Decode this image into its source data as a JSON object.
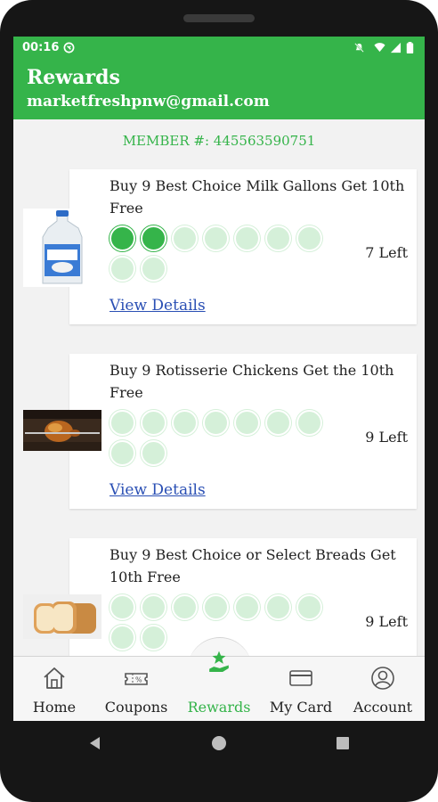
{
  "status_bar": {
    "time": "00:16"
  },
  "app_bar": {
    "title": "Rewards",
    "email": "marketfreshpnw@gmail.com"
  },
  "member": {
    "label": "MEMBER #: 445563590751"
  },
  "rewards": [
    {
      "title": "Buy 9 Best Choice Milk Gallons Get 10th Free",
      "stamps_total": 9,
      "stamps_filled": 2,
      "left": "7 Left",
      "link": "View Details",
      "image": "milk-gallon"
    },
    {
      "title": "Buy 9 Rotisserie Chickens Get the 10th Free",
      "stamps_total": 9,
      "stamps_filled": 0,
      "left": "9 Left",
      "link": "View Details",
      "image": "rotisserie-chicken"
    },
    {
      "title": "Buy 9 Best Choice or Select Breads Get 10th Free",
      "stamps_total": 9,
      "stamps_filled": 0,
      "left": "9 Left",
      "image": "bread-loaf"
    }
  ],
  "nav": {
    "items": [
      {
        "label": "Home",
        "icon": "home-icon"
      },
      {
        "label": "Coupons",
        "icon": "coupon-icon"
      },
      {
        "label": "Rewards",
        "icon": "rewards-icon",
        "active": true
      },
      {
        "label": "My Card",
        "icon": "card-icon"
      },
      {
        "label": "Account",
        "icon": "account-icon"
      }
    ]
  },
  "colors": {
    "brand_green": "#35b44a",
    "stamp_empty": "#d5f0d9",
    "link": "#2a4fb4"
  }
}
